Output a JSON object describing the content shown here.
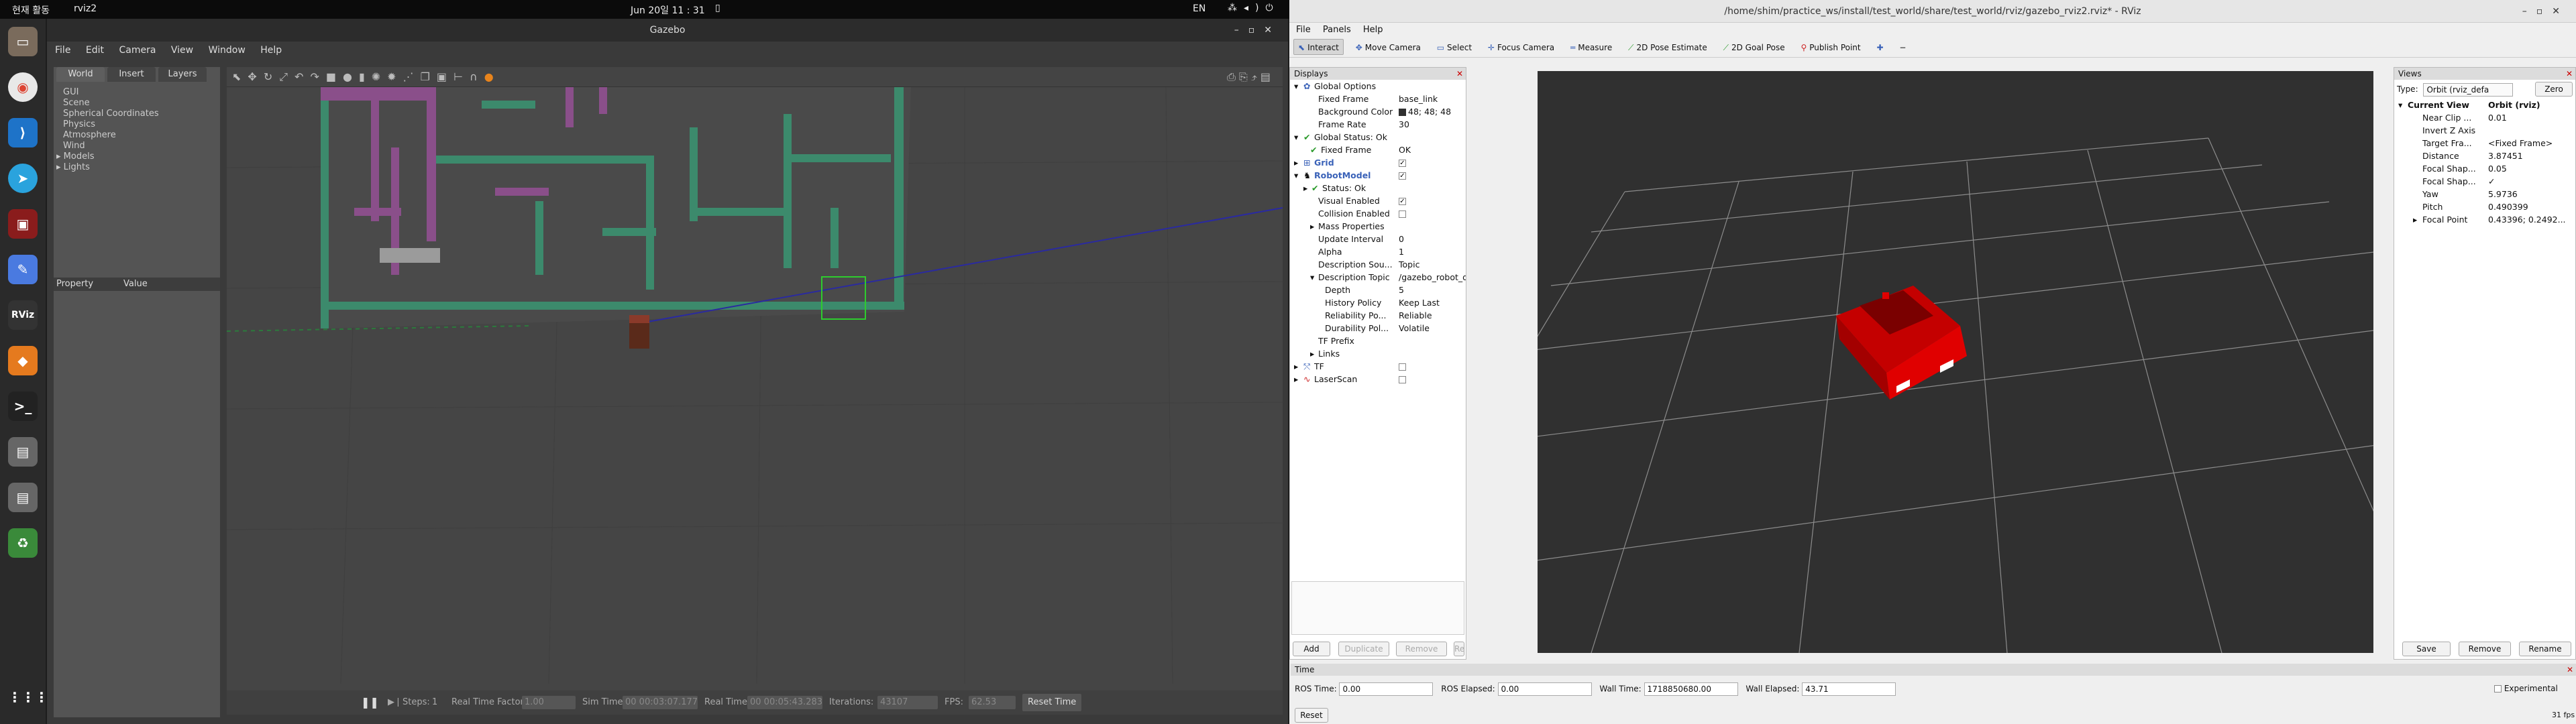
{
  "topbar": {
    "activities": "현재 활동",
    "app": "rviz2",
    "clock": "Jun 20일  11 : 31",
    "lang": "EN"
  },
  "gazebo": {
    "title": "Gazebo",
    "menu": [
      "File",
      "Edit",
      "Camera",
      "View",
      "Window",
      "Help"
    ],
    "tabs": [
      "World",
      "Insert",
      "Layers"
    ],
    "tree": [
      "GUI",
      "Scene",
      "Spherical Coordinates",
      "Physics",
      "Atmosphere",
      "Wind",
      "Models",
      "Lights"
    ],
    "prop_headers": [
      "Property",
      "Value"
    ],
    "bottom": {
      "steps_label": "Steps:",
      "steps_val": "1",
      "rtf_label": "Real Time Factor:",
      "rtf_val": "1.00",
      "sim_label": "Sim Time:",
      "sim_val": "00 00:03:07.177",
      "real_label": "Real Time:",
      "real_val": "00 00:05:43.283",
      "iter_label": "Iterations:",
      "iter_val": "43107",
      "fps_label": "FPS:",
      "fps_val": "62.53",
      "reset": "Reset Time"
    }
  },
  "rviz": {
    "title": "/home/shim/practice_ws/install/test_world/share/test_world/rviz/gazebo_rviz2.rviz* - RViz",
    "menu": [
      "File",
      "Panels",
      "Help"
    ],
    "tools": [
      "Interact",
      "Move Camera",
      "Select",
      "Focus Camera",
      "Measure",
      "2D Pose Estimate",
      "2D Goal Pose",
      "Publish Point"
    ],
    "displays_title": "Displays",
    "displays": [
      {
        "k": "Global Options",
        "v": ""
      },
      {
        "k": "Fixed Frame",
        "v": "base_link"
      },
      {
        "k": "Background Color",
        "v": "48; 48; 48"
      },
      {
        "k": "Frame Rate",
        "v": "30"
      },
      {
        "k": "Global Status: Ok",
        "v": ""
      },
      {
        "k": "Fixed Frame",
        "v": "OK"
      },
      {
        "k": "Grid",
        "v": ""
      },
      {
        "k": "RobotModel",
        "v": ""
      },
      {
        "k": "Status: Ok",
        "v": ""
      },
      {
        "k": "Visual Enabled",
        "v": ""
      },
      {
        "k": "Collision Enabled",
        "v": ""
      },
      {
        "k": "Mass Properties",
        "v": ""
      },
      {
        "k": "Update Interval",
        "v": "0"
      },
      {
        "k": "Alpha",
        "v": "1"
      },
      {
        "k": "Description Sou...",
        "v": "Topic"
      },
      {
        "k": "Description Topic",
        "v": "/gazebo_robot_descri..."
      },
      {
        "k": "Depth",
        "v": "5"
      },
      {
        "k": "History Policy",
        "v": "Keep Last"
      },
      {
        "k": "Reliability Po...",
        "v": "Reliable"
      },
      {
        "k": "Durability Pol...",
        "v": "Volatile"
      },
      {
        "k": "TF Prefix",
        "v": ""
      },
      {
        "k": "Links",
        "v": ""
      },
      {
        "k": "TF",
        "v": ""
      },
      {
        "k": "LaserScan",
        "v": ""
      }
    ],
    "disp_buttons": [
      "Add",
      "Duplicate",
      "Remove",
      "Rename"
    ],
    "views_title": "Views",
    "type_label": "Type:",
    "type_val": "Orbit (rviz_defa",
    "zero": "Zero",
    "views": [
      {
        "k": "Current View",
        "v": "Orbit (rviz)"
      },
      {
        "k": "Near Clip ...",
        "v": "0.01"
      },
      {
        "k": "Invert Z Axis",
        "v": ""
      },
      {
        "k": "Target Fra...",
        "v": "<Fixed Frame>"
      },
      {
        "k": "Distance",
        "v": "3.87451"
      },
      {
        "k": "Focal Shap...",
        "v": "0.05"
      },
      {
        "k": "Focal Shap...",
        "v": "✓"
      },
      {
        "k": "Yaw",
        "v": "5.9736"
      },
      {
        "k": "Pitch",
        "v": "0.490399"
      },
      {
        "k": "Focal Point",
        "v": "0.43396; 0.2492..."
      }
    ],
    "views_buttons": [
      "Save",
      "Remove",
      "Rename"
    ],
    "time_title": "Time",
    "ros_time_label": "ROS Time:",
    "ros_time": "0.00",
    "ros_elapsed_label": "ROS Elapsed:",
    "ros_elapsed": "0.00",
    "wall_time_label": "Wall Time:",
    "wall_time": "1718850680.00",
    "wall_elapsed_label": "Wall Elapsed:",
    "wall_elapsed": "43.71",
    "experimental": "Experimental",
    "reset": "Reset",
    "fps": "31 fps"
  }
}
